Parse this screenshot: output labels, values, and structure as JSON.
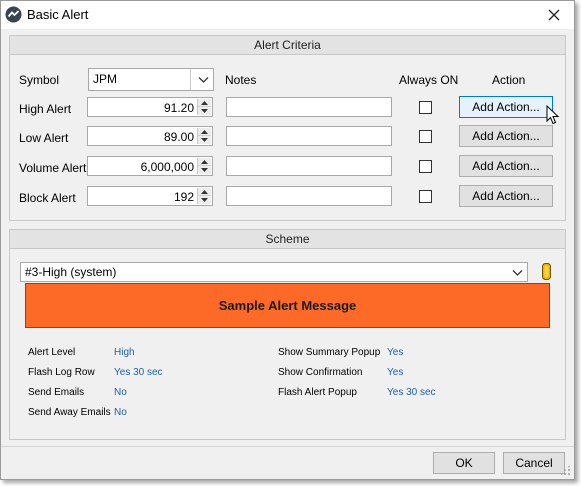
{
  "window": {
    "title": "Basic Alert"
  },
  "criteria": {
    "header": "Alert Criteria",
    "columns": {
      "symbol": "Symbol",
      "notes": "Notes",
      "always_on": "Always ON",
      "action": "Action"
    },
    "symbol_value": "JPM",
    "rows": [
      {
        "label": "High Alert",
        "value": "91.20",
        "notes": "",
        "always_on": false,
        "action_label": "Add Action..."
      },
      {
        "label": "Low Alert",
        "value": "89.00",
        "notes": "",
        "always_on": false,
        "action_label": "Add Action..."
      },
      {
        "label": "Volume Alert",
        "value": "6,000,000",
        "notes": "",
        "always_on": false,
        "action_label": "Add Action..."
      },
      {
        "label": "Block Alert",
        "value": "192",
        "notes": "",
        "always_on": false,
        "action_label": "Add Action..."
      }
    ]
  },
  "scheme": {
    "header": "Scheme",
    "selected": "#3-High (system)",
    "sample_message": "Sample Alert Message",
    "sample_color": "#fd6a28",
    "details_left": [
      {
        "key": "Alert Level",
        "value": "High"
      },
      {
        "key": "Flash Log Row",
        "value": "Yes 30 sec"
      },
      {
        "key": "Send Emails",
        "value": "No"
      },
      {
        "key": "Send Away Emails",
        "value": "No"
      }
    ],
    "details_right": [
      {
        "key": "Show Summary Popup",
        "value": "Yes"
      },
      {
        "key": "Show Confirmation",
        "value": "Yes"
      },
      {
        "key": "Flash Alert Popup",
        "value": "Yes 30 sec"
      }
    ]
  },
  "footer": {
    "ok_label": "OK",
    "cancel_label": "Cancel"
  }
}
